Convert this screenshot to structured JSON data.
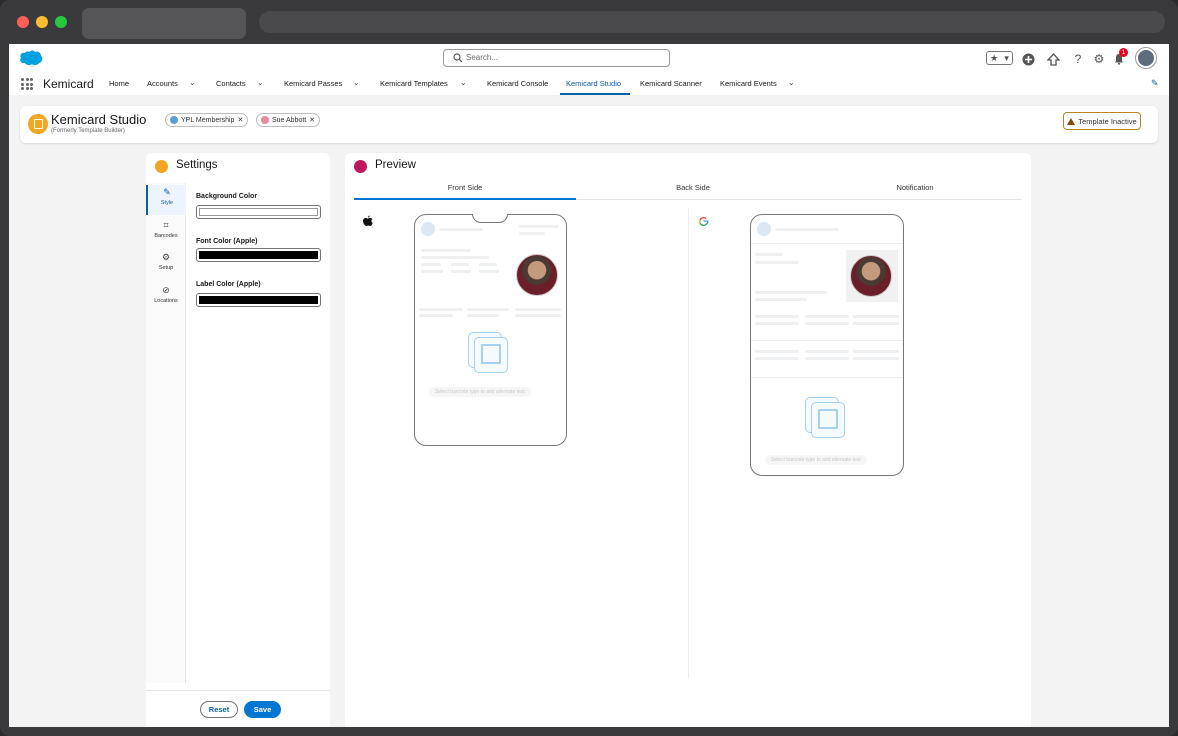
{
  "header": {
    "search_placeholder": "Search...",
    "app_name": "Kemicard",
    "notification_count": "1",
    "nav": [
      {
        "label": "Home"
      },
      {
        "label": "Accounts"
      },
      {
        "label": "Contacts"
      },
      {
        "label": "Kemicard Passes"
      },
      {
        "label": "Kemicard Templates"
      },
      {
        "label": "Kemicard Console"
      },
      {
        "label": "Kemicard Studio"
      },
      {
        "label": "Kemicard Scanner"
      },
      {
        "label": "Kemicard Events"
      }
    ]
  },
  "studio": {
    "title": "Kemicard Studio",
    "subtitle": "(Formerly Template Builder)",
    "pills": [
      "YPL Membership",
      "Sue Abbott"
    ],
    "status": "Template Inactive"
  },
  "settings": {
    "title": "Settings",
    "tabs": [
      {
        "label": "Style",
        "icon": "brush-icon"
      },
      {
        "label": "Barcodes",
        "icon": "barcode-icon"
      },
      {
        "label": "Setup",
        "icon": "gear-icon"
      },
      {
        "label": "Locations",
        "icon": "location-icon"
      }
    ],
    "fields": [
      {
        "label": "Background Color",
        "color": "#ffffff"
      },
      {
        "label": "Font Color (Apple)",
        "color": "#000000"
      },
      {
        "label": "Label Color (Apple)",
        "color": "#000000"
      }
    ],
    "reset_label": "Reset",
    "save_label": "Save"
  },
  "preview": {
    "title": "Preview",
    "tabs": [
      "Front Side",
      "Back Side",
      "Notification"
    ],
    "barcode_hint": "Select barcode type to add alternate text"
  },
  "colors": {
    "accent": "#0176d3",
    "studio_icon": "#f2a623",
    "preview_icon": "#c2185b",
    "warning": "#8c4b02"
  }
}
